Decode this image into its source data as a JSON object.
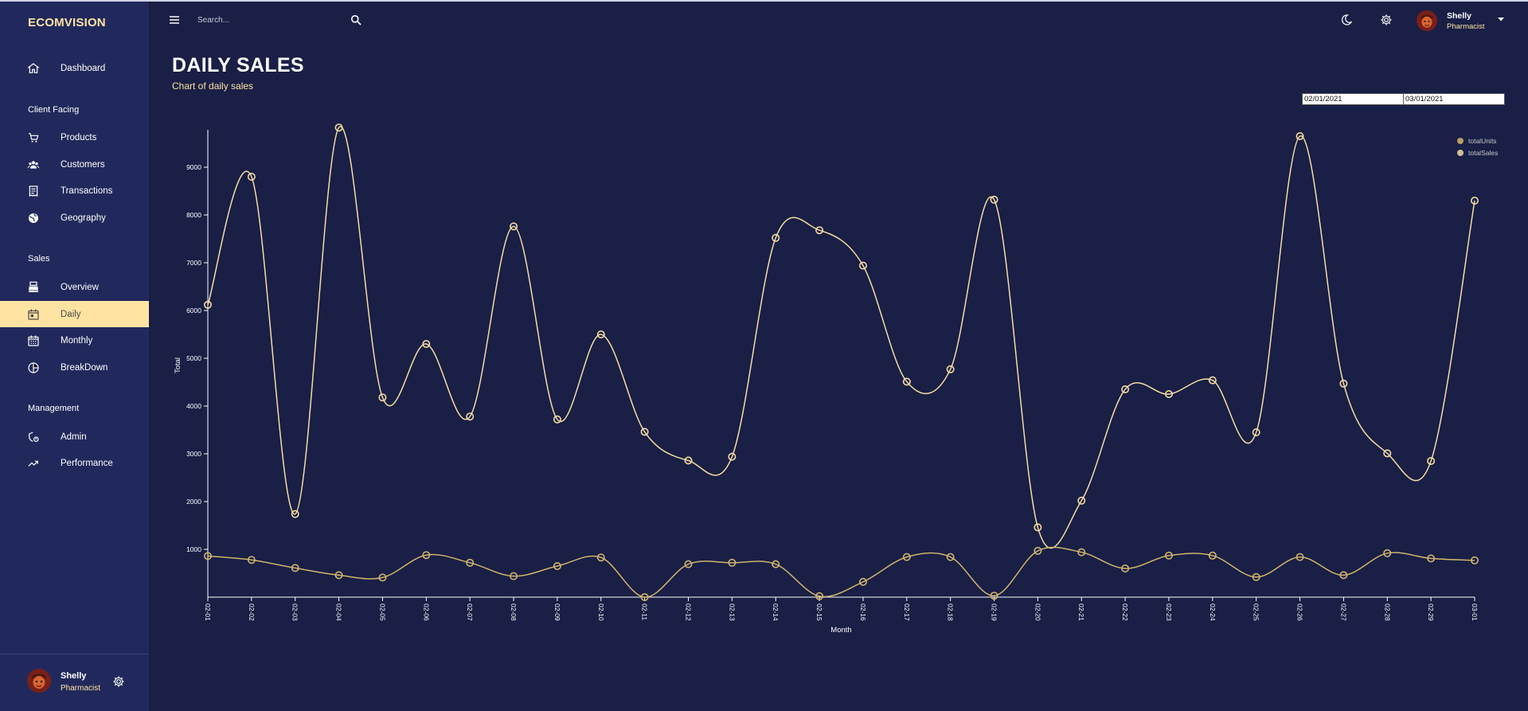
{
  "sidebar": {
    "brand": "ECOMVISION",
    "items": [
      {
        "label": "Dashboard",
        "icon": "home-icon"
      },
      {
        "section": "Client Facing"
      },
      {
        "label": "Products",
        "icon": "cart-icon"
      },
      {
        "label": "Customers",
        "icon": "groups-icon"
      },
      {
        "label": "Transactions",
        "icon": "receipt-icon"
      },
      {
        "label": "Geography",
        "icon": "globe-icon"
      },
      {
        "section": "Sales"
      },
      {
        "label": "Overview",
        "icon": "point-of-sale-icon"
      },
      {
        "label": "Daily",
        "icon": "calendar-today-icon",
        "active": true
      },
      {
        "label": "Monthly",
        "icon": "calendar-month-icon"
      },
      {
        "label": "BreakDown",
        "icon": "pie-chart-icon"
      },
      {
        "section": "Management"
      },
      {
        "label": "Admin",
        "icon": "admin-icon"
      },
      {
        "label": "Performance",
        "icon": "trending-up-icon"
      }
    ],
    "user": {
      "name": "Shelly",
      "role": "Pharmacist"
    }
  },
  "topbar": {
    "search_placeholder": "Search...",
    "user": {
      "name": "Shelly",
      "role": "Pharmacist"
    }
  },
  "header": {
    "title": "DAILY SALES",
    "subtitle": "Chart of daily sales"
  },
  "date_range": {
    "start": "02/01/2021",
    "end": "03/01/2021"
  },
  "colors": {
    "accent": "#ffe3a3",
    "background": "#191f45",
    "sidebar": "#21295c",
    "sales_line": "#f5dca3",
    "units_line": "#d1b46d"
  },
  "chart_data": {
    "type": "line",
    "curve": "smooth",
    "xlabel": "Month",
    "ylabel": "Total",
    "ylim": [
      0,
      9700
    ],
    "yticks": [
      1000,
      2000,
      3000,
      4000,
      5000,
      6000,
      7000,
      8000,
      9000
    ],
    "legend_position": "top-right",
    "grid": false,
    "categories": [
      "02-01",
      "02-02",
      "02-03",
      "02-04",
      "02-05",
      "02-06",
      "02-07",
      "02-08",
      "02-09",
      "02-10",
      "02-11",
      "02-12",
      "02-13",
      "02-14",
      "02-15",
      "02-16",
      "02-17",
      "02-18",
      "02-19",
      "02-20",
      "02-21",
      "02-22",
      "02-23",
      "02-24",
      "02-25",
      "02-26",
      "02-27",
      "02-28",
      "02-29",
      "03-01"
    ],
    "series": [
      {
        "name": "totalSales",
        "color": "#f5dca3",
        "values": [
          6120,
          8800,
          1740,
          9830,
          4180,
          5300,
          3780,
          7760,
          3720,
          5500,
          3460,
          2860,
          2940,
          7520,
          7680,
          6940,
          4510,
          4770,
          8320,
          1460,
          2020,
          4350,
          4250,
          4540,
          3450,
          9650,
          4470,
          3010,
          2850,
          8300
        ]
      },
      {
        "name": "totalUnits",
        "color": "#d1b46d",
        "values": [
          860,
          780,
          610,
          460,
          410,
          880,
          720,
          440,
          650,
          830,
          0,
          690,
          720,
          690,
          20,
          320,
          840,
          840,
          30,
          970,
          940,
          600,
          870,
          870,
          420,
          840,
          460,
          920,
          810,
          770
        ]
      }
    ]
  }
}
